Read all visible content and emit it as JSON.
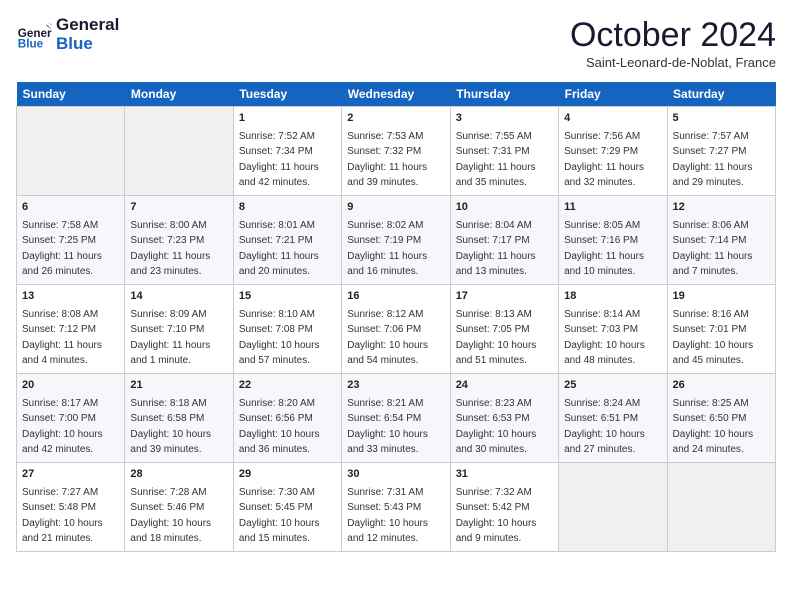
{
  "header": {
    "logo_line1": "General",
    "logo_line2": "Blue",
    "month": "October 2024",
    "location": "Saint-Leonard-de-Noblat, France"
  },
  "days_of_week": [
    "Sunday",
    "Monday",
    "Tuesday",
    "Wednesday",
    "Thursday",
    "Friday",
    "Saturday"
  ],
  "weeks": [
    [
      {
        "day": "",
        "empty": true
      },
      {
        "day": "",
        "empty": true
      },
      {
        "day": "1",
        "sunrise": "7:52 AM",
        "sunset": "7:34 PM",
        "daylight": "11 hours and 42 minutes."
      },
      {
        "day": "2",
        "sunrise": "7:53 AM",
        "sunset": "7:32 PM",
        "daylight": "11 hours and 39 minutes."
      },
      {
        "day": "3",
        "sunrise": "7:55 AM",
        "sunset": "7:31 PM",
        "daylight": "11 hours and 35 minutes."
      },
      {
        "day": "4",
        "sunrise": "7:56 AM",
        "sunset": "7:29 PM",
        "daylight": "11 hours and 32 minutes."
      },
      {
        "day": "5",
        "sunrise": "7:57 AM",
        "sunset": "7:27 PM",
        "daylight": "11 hours and 29 minutes."
      }
    ],
    [
      {
        "day": "6",
        "sunrise": "7:58 AM",
        "sunset": "7:25 PM",
        "daylight": "11 hours and 26 minutes."
      },
      {
        "day": "7",
        "sunrise": "8:00 AM",
        "sunset": "7:23 PM",
        "daylight": "11 hours and 23 minutes."
      },
      {
        "day": "8",
        "sunrise": "8:01 AM",
        "sunset": "7:21 PM",
        "daylight": "11 hours and 20 minutes."
      },
      {
        "day": "9",
        "sunrise": "8:02 AM",
        "sunset": "7:19 PM",
        "daylight": "11 hours and 16 minutes."
      },
      {
        "day": "10",
        "sunrise": "8:04 AM",
        "sunset": "7:17 PM",
        "daylight": "11 hours and 13 minutes."
      },
      {
        "day": "11",
        "sunrise": "8:05 AM",
        "sunset": "7:16 PM",
        "daylight": "11 hours and 10 minutes."
      },
      {
        "day": "12",
        "sunrise": "8:06 AM",
        "sunset": "7:14 PM",
        "daylight": "11 hours and 7 minutes."
      }
    ],
    [
      {
        "day": "13",
        "sunrise": "8:08 AM",
        "sunset": "7:12 PM",
        "daylight": "11 hours and 4 minutes."
      },
      {
        "day": "14",
        "sunrise": "8:09 AM",
        "sunset": "7:10 PM",
        "daylight": "11 hours and 1 minute."
      },
      {
        "day": "15",
        "sunrise": "8:10 AM",
        "sunset": "7:08 PM",
        "daylight": "10 hours and 57 minutes."
      },
      {
        "day": "16",
        "sunrise": "8:12 AM",
        "sunset": "7:06 PM",
        "daylight": "10 hours and 54 minutes."
      },
      {
        "day": "17",
        "sunrise": "8:13 AM",
        "sunset": "7:05 PM",
        "daylight": "10 hours and 51 minutes."
      },
      {
        "day": "18",
        "sunrise": "8:14 AM",
        "sunset": "7:03 PM",
        "daylight": "10 hours and 48 minutes."
      },
      {
        "day": "19",
        "sunrise": "8:16 AM",
        "sunset": "7:01 PM",
        "daylight": "10 hours and 45 minutes."
      }
    ],
    [
      {
        "day": "20",
        "sunrise": "8:17 AM",
        "sunset": "7:00 PM",
        "daylight": "10 hours and 42 minutes."
      },
      {
        "day": "21",
        "sunrise": "8:18 AM",
        "sunset": "6:58 PM",
        "daylight": "10 hours and 39 minutes."
      },
      {
        "day": "22",
        "sunrise": "8:20 AM",
        "sunset": "6:56 PM",
        "daylight": "10 hours and 36 minutes."
      },
      {
        "day": "23",
        "sunrise": "8:21 AM",
        "sunset": "6:54 PM",
        "daylight": "10 hours and 33 minutes."
      },
      {
        "day": "24",
        "sunrise": "8:23 AM",
        "sunset": "6:53 PM",
        "daylight": "10 hours and 30 minutes."
      },
      {
        "day": "25",
        "sunrise": "8:24 AM",
        "sunset": "6:51 PM",
        "daylight": "10 hours and 27 minutes."
      },
      {
        "day": "26",
        "sunrise": "8:25 AM",
        "sunset": "6:50 PM",
        "daylight": "10 hours and 24 minutes."
      }
    ],
    [
      {
        "day": "27",
        "sunrise": "7:27 AM",
        "sunset": "5:48 PM",
        "daylight": "10 hours and 21 minutes."
      },
      {
        "day": "28",
        "sunrise": "7:28 AM",
        "sunset": "5:46 PM",
        "daylight": "10 hours and 18 minutes."
      },
      {
        "day": "29",
        "sunrise": "7:30 AM",
        "sunset": "5:45 PM",
        "daylight": "10 hours and 15 minutes."
      },
      {
        "day": "30",
        "sunrise": "7:31 AM",
        "sunset": "5:43 PM",
        "daylight": "10 hours and 12 minutes."
      },
      {
        "day": "31",
        "sunrise": "7:32 AM",
        "sunset": "5:42 PM",
        "daylight": "10 hours and 9 minutes."
      },
      {
        "day": "",
        "empty": true
      },
      {
        "day": "",
        "empty": true
      }
    ]
  ]
}
